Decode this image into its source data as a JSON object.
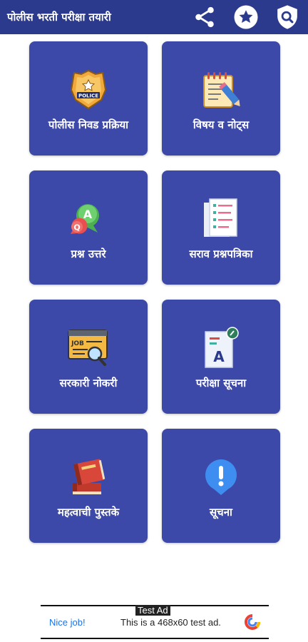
{
  "app_bar": {
    "title": "पोलीस भरती परीक्षा तयारी",
    "actions": [
      {
        "icon": "share-icon"
      },
      {
        "icon": "star-icon"
      },
      {
        "icon": "search-shield-icon"
      }
    ]
  },
  "tiles": [
    {
      "label": "पोलीस निवड प्रक्रिया",
      "icon": "police-badge-icon"
    },
    {
      "label": "विषय व नोट्स",
      "icon": "notebook-pencil-icon"
    },
    {
      "label": "प्रश्न उत्तरे",
      "icon": "qa-bubbles-icon"
    },
    {
      "label": "सराव प्रश्नपत्रिका",
      "icon": "question-paper-icon"
    },
    {
      "label": "सरकारी नोकरी",
      "icon": "job-search-icon"
    },
    {
      "label": "परीक्षा सूचना",
      "icon": "exam-notice-icon"
    },
    {
      "label": "महत्वाची पुस्तके",
      "icon": "books-icon"
    },
    {
      "label": "सूचना",
      "icon": "notification-icon"
    }
  ],
  "ad": {
    "tag": "Test Ad",
    "headline": "Nice job!",
    "message": "This is a 468x60 test ad."
  },
  "colors": {
    "appbar": "#2b3a8c",
    "tile": "#3d49a8",
    "white": "#ffffff"
  }
}
